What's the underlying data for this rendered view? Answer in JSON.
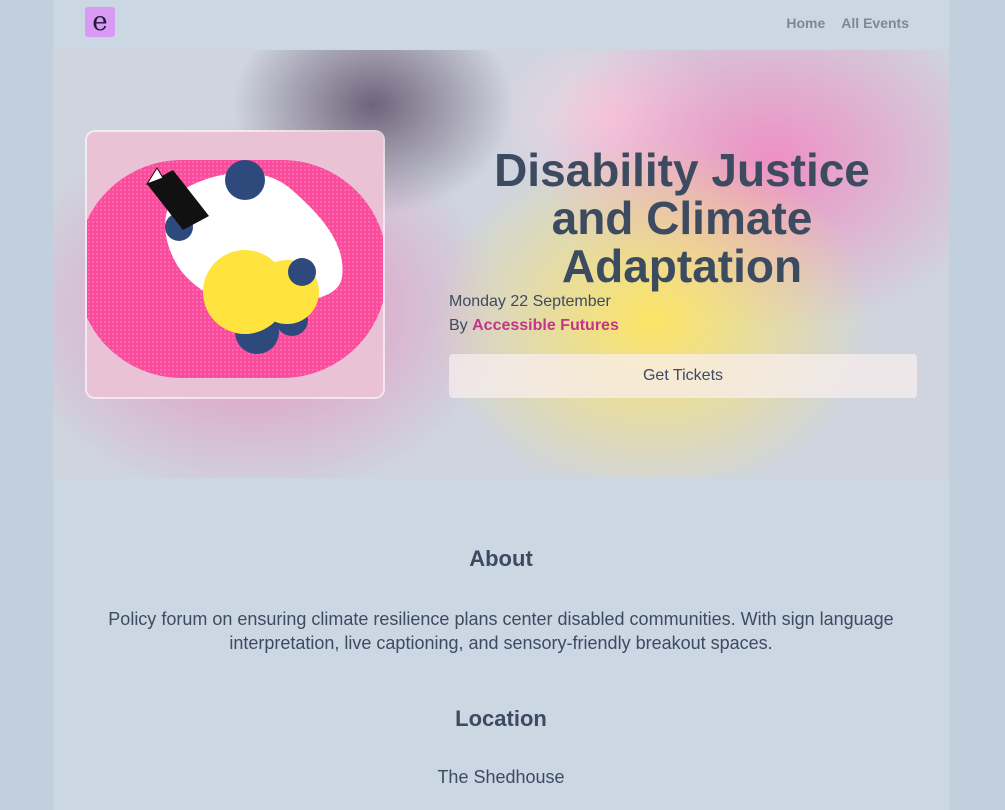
{
  "header": {
    "logo_letter": "e",
    "nav": [
      {
        "label": "Home"
      },
      {
        "label": "All Events"
      }
    ]
  },
  "event": {
    "title": "Disability Justice and Climate Adaptation",
    "date": "Monday 22 September",
    "by_prefix": "By",
    "organizer": "Accessible Futures",
    "tickets_label": "Get Tickets"
  },
  "about": {
    "heading": "About",
    "text": "Policy forum on ensuring climate resilience plans center disabled communities. With sign language interpretation, live captioning, and sensory-friendly breakout spaces."
  },
  "location": {
    "heading": "Location",
    "venue": "The Shedhouse"
  },
  "colors": {
    "accent": "#c5348c",
    "logo_bg": "#d89af2",
    "text": "#3d4b61",
    "page_bg": "#ccd7e4"
  }
}
